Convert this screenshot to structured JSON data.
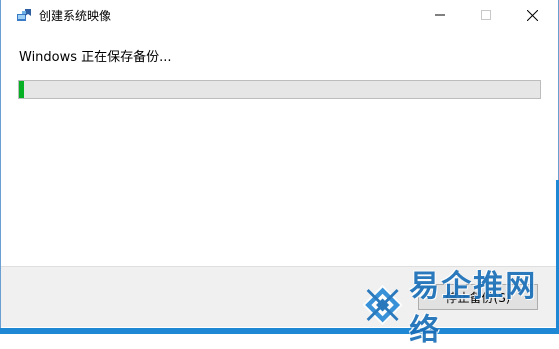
{
  "window": {
    "title": "创建系统映像",
    "controls": [
      "minimize",
      "maximize",
      "close"
    ]
  },
  "status": {
    "message": "Windows 正在保存备份..."
  },
  "progress": {
    "value": 0.01,
    "color": "#06b025"
  },
  "footer": {
    "stop_button_label": "停止备份(S)"
  },
  "watermark": {
    "text": "易企推网络",
    "color": "#1a6fb8"
  },
  "colors": {
    "accent_desktop": "#1e88d4",
    "progress_track": "#e6e6e6"
  }
}
